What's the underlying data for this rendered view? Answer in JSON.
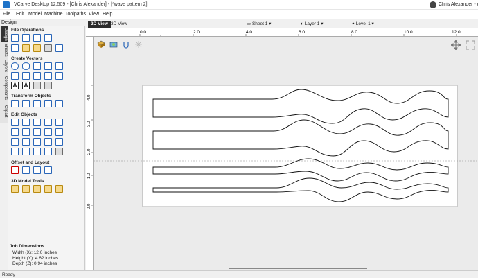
{
  "window": {
    "title": "VCarve Desktop 12.509 - [Chris Alexander] - [*wave pattern 2]",
    "user": "Chris Alexander - chris"
  },
  "menu": [
    "File",
    "Edit",
    "Model",
    "Machine",
    "Toolpaths",
    "View",
    "Help"
  ],
  "design_label": "Design",
  "side_tabs": [
    "Design",
    "Sheets",
    "Layers",
    "Components",
    "Clipart"
  ],
  "sections": {
    "file_ops": "File Operations",
    "create_vectors": "Create Vectors",
    "transform": "Transform Objects",
    "edit": "Edit Objects",
    "offset": "Offset and Layout",
    "model_tools": "3D Model Tools"
  },
  "job": {
    "title": "Job Dimensions",
    "width": "Width  (X): 12.0 inches",
    "height": "Height (Y): 4.62 inches",
    "depth": "Depth  (Z): 0.94 inches"
  },
  "view_tabs": {
    "tab_2d": "2D View",
    "tab_3d": "3D View"
  },
  "selectors": {
    "sheet": "Sheet 1",
    "layer": "Layer 1",
    "level": "Level 1"
  },
  "h_ruler_labels": [
    "0.0",
    "2.0",
    "4.0",
    "6.0",
    "8.0",
    "10.0",
    "12.0"
  ],
  "v_ruler_labels": [
    "4.0",
    "3.0",
    "2.0",
    "1.0",
    "0.0"
  ],
  "status": "Ready",
  "icons": {
    "avatar": "user-avatar-icon",
    "pan": "pan-icon",
    "expand": "expand-icon"
  }
}
